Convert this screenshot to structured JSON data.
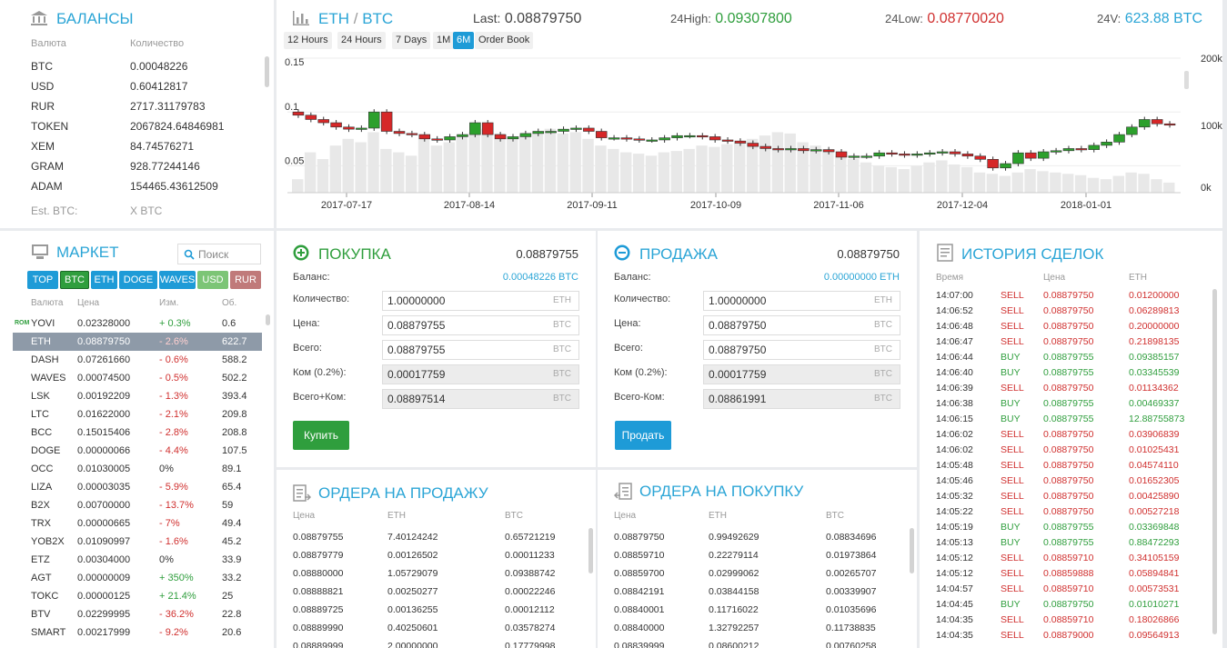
{
  "balances": {
    "title": "БАЛАНСЫ",
    "col_currency": "Валюта",
    "col_amount": "Количество",
    "rows": [
      [
        "BTC",
        "0.00048226"
      ],
      [
        "USD",
        "0.60412817"
      ],
      [
        "RUR",
        "2717.31179783"
      ],
      [
        "TOKEN",
        "2067824.64846981"
      ],
      [
        "XEM",
        "84.74576271"
      ],
      [
        "GRAM",
        "928.77244146"
      ],
      [
        "ADAM",
        "154465.43612509"
      ]
    ],
    "est_label": "Est. BTC:",
    "est_value": "X BTC"
  },
  "market": {
    "title": "МАРКЕТ",
    "search_placeholder": "Поиск",
    "tabs": [
      "TOP",
      "BTC",
      "ETH",
      "DOGE",
      "WAVES",
      "USD",
      "RUR"
    ],
    "col_currency": "Валюта",
    "col_price": "Цена",
    "col_change": "Изм.",
    "col_volume": "Об.",
    "badge": "ROM",
    "rows": [
      [
        "YOVI",
        "0.02328000",
        "+ 0.3%",
        "0.6"
      ],
      [
        "ETH",
        "0.08879750",
        "- 2.6%",
        "622.7"
      ],
      [
        "DASH",
        "0.07261660",
        "- 0.6%",
        "588.2"
      ],
      [
        "WAVES",
        "0.00074500",
        "- 0.5%",
        "502.2"
      ],
      [
        "LSK",
        "0.00192209",
        "- 1.3%",
        "393.4"
      ],
      [
        "LTC",
        "0.01622000",
        "- 2.1%",
        "209.8"
      ],
      [
        "BCC",
        "0.15015406",
        "- 2.8%",
        "208.8"
      ],
      [
        "DOGE",
        "0.00000066",
        "- 4.4%",
        "107.5"
      ],
      [
        "OCC",
        "0.01030005",
        "0%",
        "89.1"
      ],
      [
        "LIZA",
        "0.00003035",
        "- 5.9%",
        "65.4"
      ],
      [
        "B2X",
        "0.00700000",
        "- 13.7%",
        "59"
      ],
      [
        "TRX",
        "0.00000665",
        "- 7%",
        "49.4"
      ],
      [
        "YOB2X",
        "0.01090997",
        "- 1.6%",
        "45.2"
      ],
      [
        "ETZ",
        "0.00304000",
        "0%",
        "33.9"
      ],
      [
        "AGT",
        "0.00000009",
        "+ 350%",
        "33.2"
      ],
      [
        "TOKC",
        "0.00000125",
        "+ 21.4%",
        "25"
      ],
      [
        "BTV",
        "0.02299995",
        "- 36.2%",
        "22.8"
      ],
      [
        "SMART",
        "0.00217999",
        "- 9.2%",
        "20.6"
      ]
    ]
  },
  "header": {
    "pair_base": "ETH",
    "pair_sep": "/",
    "pair_quote": "BTC",
    "last_label": "Last:",
    "last_value": "0.08879750",
    "high_label": "24High:",
    "high_value": "0.09307800",
    "low_label": "24Low:",
    "low_value": "0.08770020",
    "vol_label": "24V:",
    "vol_value": "623.88 BTC"
  },
  "chart_tabs": [
    "12 Hours",
    "24 Hours",
    "7 Days",
    "1M",
    "6M",
    "Order Book"
  ],
  "chart_data": {
    "type": "candlestick",
    "x_labels": [
      "2017-07-17",
      "2017-08-14",
      "2017-09-11",
      "2017-10-09",
      "2017-11-06",
      "2017-12-04",
      "2018-01-01"
    ],
    "y_left_ticks": [
      "0.15",
      "0.1",
      "0.05"
    ],
    "y_right_ticks": [
      "200k",
      "100k",
      "0k"
    ],
    "ylim": [
      0.025,
      0.15
    ],
    "candles": [
      [
        0.1,
        0.097
      ],
      [
        0.097,
        0.093
      ],
      [
        0.093,
        0.09
      ],
      [
        0.09,
        0.086
      ],
      [
        0.086,
        0.084
      ],
      [
        0.084,
        0.085
      ],
      [
        0.085,
        0.1
      ],
      [
        0.1,
        0.082
      ],
      [
        0.082,
        0.08
      ],
      [
        0.08,
        0.079
      ],
      [
        0.079,
        0.075
      ],
      [
        0.075,
        0.074
      ],
      [
        0.074,
        0.077
      ],
      [
        0.077,
        0.079
      ],
      [
        0.079,
        0.09
      ],
      [
        0.09,
        0.079
      ],
      [
        0.079,
        0.075
      ],
      [
        0.075,
        0.077
      ],
      [
        0.077,
        0.08
      ],
      [
        0.08,
        0.082
      ],
      [
        0.082,
        0.082
      ],
      [
        0.082,
        0.084
      ],
      [
        0.084,
        0.085
      ],
      [
        0.085,
        0.082
      ],
      [
        0.082,
        0.076
      ],
      [
        0.076,
        0.076
      ],
      [
        0.076,
        0.075
      ],
      [
        0.075,
        0.074
      ],
      [
        0.074,
        0.074
      ],
      [
        0.074,
        0.076
      ],
      [
        0.076,
        0.078
      ],
      [
        0.078,
        0.078
      ],
      [
        0.078,
        0.077
      ],
      [
        0.077,
        0.074
      ],
      [
        0.074,
        0.073
      ],
      [
        0.073,
        0.071
      ],
      [
        0.071,
        0.068
      ],
      [
        0.068,
        0.066
      ],
      [
        0.066,
        0.065
      ],
      [
        0.065,
        0.066
      ],
      [
        0.066,
        0.064
      ],
      [
        0.064,
        0.065
      ],
      [
        0.065,
        0.063
      ],
      [
        0.063,
        0.058
      ],
      [
        0.058,
        0.059
      ],
      [
        0.059,
        0.059
      ],
      [
        0.059,
        0.062
      ],
      [
        0.062,
        0.061
      ],
      [
        0.061,
        0.06
      ],
      [
        0.06,
        0.061
      ],
      [
        0.061,
        0.062
      ],
      [
        0.062,
        0.063
      ],
      [
        0.063,
        0.061
      ],
      [
        0.061,
        0.059
      ],
      [
        0.059,
        0.056
      ],
      [
        0.056,
        0.048
      ],
      [
        0.048,
        0.052
      ],
      [
        0.052,
        0.062
      ],
      [
        0.062,
        0.057
      ],
      [
        0.057,
        0.063
      ],
      [
        0.063,
        0.064
      ],
      [
        0.064,
        0.066
      ],
      [
        0.066,
        0.065
      ],
      [
        0.065,
        0.069
      ],
      [
        0.069,
        0.072
      ],
      [
        0.072,
        0.079
      ],
      [
        0.079,
        0.086
      ],
      [
        0.086,
        0.093
      ],
      [
        0.093,
        0.089
      ],
      [
        0.089,
        0.088
      ]
    ],
    "volumes": [
      20,
      60,
      50,
      70,
      80,
      75,
      90,
      65,
      60,
      55,
      80,
      70,
      75,
      85,
      90,
      95,
      88,
      80,
      85,
      90,
      95,
      88,
      90,
      80,
      70,
      65,
      60,
      58,
      55,
      60,
      62,
      65,
      70,
      68,
      72,
      75,
      80,
      85,
      90,
      88,
      75,
      70,
      65,
      55,
      50,
      45,
      40,
      38,
      35,
      40,
      45,
      48,
      42,
      38,
      30,
      28,
      25,
      30,
      35,
      32,
      30,
      28,
      26,
      22,
      20,
      25,
      30,
      28,
      20,
      15
    ]
  },
  "buy": {
    "title": "ПОКУПКА",
    "price": "0.08879755",
    "balance_label": "Баланс:",
    "balance_value": "0.00048226 BTC",
    "fields": [
      [
        "Количество:",
        "1.00000000",
        "ETH"
      ],
      [
        "Цена:",
        "0.08879755",
        "BTC"
      ],
      [
        "Всего:",
        "0.08879755",
        "BTC"
      ],
      [
        "Ком (0.2%):",
        "0.00017759",
        "BTC"
      ],
      [
        "Всего+Ком:",
        "0.08897514",
        "BTC"
      ]
    ],
    "button": "Купить"
  },
  "sell": {
    "title": "ПРОДАЖА",
    "price": "0.08879750",
    "balance_label": "Баланс:",
    "balance_value": "0.00000000 ETH",
    "fields": [
      [
        "Количество:",
        "1.00000000",
        "ETH"
      ],
      [
        "Цена:",
        "0.08879750",
        "BTC"
      ],
      [
        "Всего:",
        "0.08879750",
        "BTC"
      ],
      [
        "Ком (0.2%):",
        "0.00017759",
        "BTC"
      ],
      [
        "Всего-Ком:",
        "0.08861991",
        "BTC"
      ]
    ],
    "button": "Продать"
  },
  "sell_orders": {
    "title": "ОРДЕРА НА ПРОДАЖУ",
    "cols": [
      "Цена",
      "ETH",
      "BTC"
    ],
    "rows": [
      [
        "0.08879755",
        "7.40124242",
        "0.65721219"
      ],
      [
        "0.08879779",
        "0.00126502",
        "0.00011233"
      ],
      [
        "0.08880000",
        "1.05729079",
        "0.09388742"
      ],
      [
        "0.08888821",
        "0.00250277",
        "0.00022246"
      ],
      [
        "0.08889725",
        "0.00136255",
        "0.00012112"
      ],
      [
        "0.08889990",
        "0.40250601",
        "0.03578274"
      ],
      [
        "0.08889999",
        "2.00000000",
        "0.17779998"
      ]
    ]
  },
  "buy_orders": {
    "title": "ОРДЕРА НА ПОКУПКУ",
    "cols": [
      "Цена",
      "ETH",
      "BTC"
    ],
    "rows": [
      [
        "0.08879750",
        "0.99492629",
        "0.08834696"
      ],
      [
        "0.08859710",
        "0.22279114",
        "0.01973864"
      ],
      [
        "0.08859700",
        "0.02999062",
        "0.00265707"
      ],
      [
        "0.08842191",
        "0.03844158",
        "0.00339907"
      ],
      [
        "0.08840001",
        "0.11716022",
        "0.01035696"
      ],
      [
        "0.08840000",
        "1.32792257",
        "0.11738835"
      ],
      [
        "0.08839999",
        "0.08600212",
        "0.00760258"
      ]
    ]
  },
  "history": {
    "title": "ИСТОРИЯ СДЕЛОК",
    "cols": [
      "Время",
      "Цена",
      "ETH"
    ],
    "rows": [
      [
        "14:07:00",
        "SELL",
        "0.08879750",
        "0.01200000"
      ],
      [
        "14:06:52",
        "SELL",
        "0.08879750",
        "0.06289813"
      ],
      [
        "14:06:48",
        "SELL",
        "0.08879750",
        "0.20000000"
      ],
      [
        "14:06:47",
        "SELL",
        "0.08879750",
        "0.21898135"
      ],
      [
        "14:06:44",
        "BUY",
        "0.08879755",
        "0.09385157"
      ],
      [
        "14:06:40",
        "BUY",
        "0.08879755",
        "0.03345539"
      ],
      [
        "14:06:39",
        "SELL",
        "0.08879750",
        "0.01134362"
      ],
      [
        "14:06:38",
        "BUY",
        "0.08879755",
        "0.00469337"
      ],
      [
        "14:06:15",
        "BUY",
        "0.08879755",
        "12.88755873"
      ],
      [
        "14:06:02",
        "SELL",
        "0.08879750",
        "0.03906839"
      ],
      [
        "14:06:02",
        "SELL",
        "0.08879750",
        "0.01025431"
      ],
      [
        "14:05:48",
        "SELL",
        "0.08879750",
        "0.04574110"
      ],
      [
        "14:05:46",
        "SELL",
        "0.08879750",
        "0.01652305"
      ],
      [
        "14:05:32",
        "SELL",
        "0.08879750",
        "0.00425890"
      ],
      [
        "14:05:22",
        "SELL",
        "0.08879750",
        "0.00527218"
      ],
      [
        "14:05:19",
        "BUY",
        "0.08879755",
        "0.03369848"
      ],
      [
        "14:05:13",
        "BUY",
        "0.08879755",
        "0.88472293"
      ],
      [
        "14:05:12",
        "SELL",
        "0.08859710",
        "0.34105159"
      ],
      [
        "14:05:12",
        "SELL",
        "0.08859888",
        "0.05894841"
      ],
      [
        "14:04:57",
        "SELL",
        "0.08859710",
        "0.00573531"
      ],
      [
        "14:04:45",
        "BUY",
        "0.08879750",
        "0.01010271"
      ],
      [
        "14:04:35",
        "SELL",
        "0.08859710",
        "0.18026866"
      ],
      [
        "14:04:35",
        "SELL",
        "0.08879000",
        "0.09564913"
      ]
    ]
  }
}
